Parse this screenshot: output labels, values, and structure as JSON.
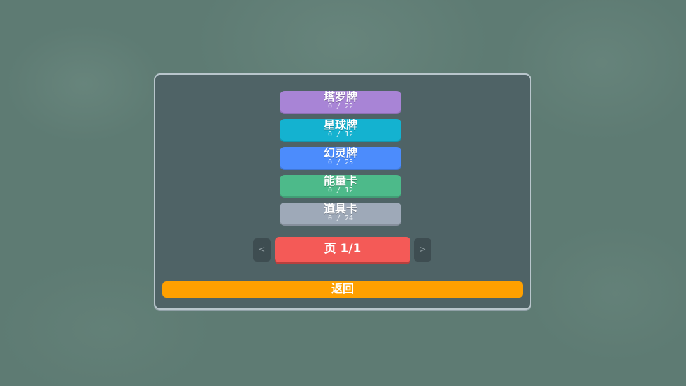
{
  "cards": [
    {
      "name": "塔罗牌",
      "count": "0 / 22",
      "color": "#a884d6"
    },
    {
      "name": "星球牌",
      "count": "0 / 12",
      "color": "#14b2d0"
    },
    {
      "name": "幻灵牌",
      "count": "0 / 25",
      "color": "#4c8cfc"
    },
    {
      "name": "能量卡",
      "count": "0 / 12",
      "color": "#4dba8a"
    },
    {
      "name": "道具卡",
      "count": "0 / 24",
      "color": "#9ea9b8"
    }
  ],
  "pager": {
    "prev_icon": "chevron-left-icon",
    "prev_label": "<",
    "page_label": "页 1/1",
    "next_icon": "chevron-right-icon",
    "next_label": ">"
  },
  "back_label": "返回",
  "colors": {
    "panel": "#4f6366",
    "page_button": "#f45a57",
    "back_button": "#ffa000"
  }
}
